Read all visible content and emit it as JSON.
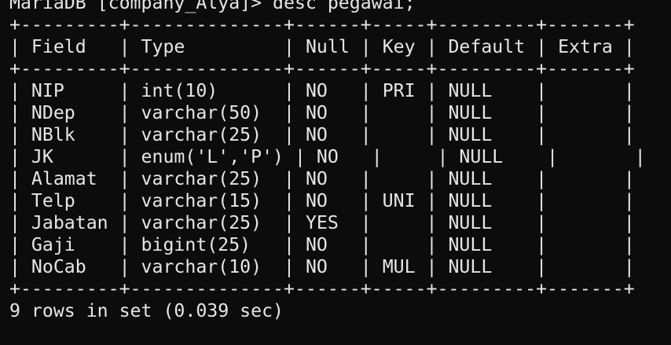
{
  "terminal": {
    "prompt": "MariaDB [company_Alya]> ",
    "command": "desc pegawai;",
    "border": "+---------+--------------+------+-----+---------+-------+",
    "headers": [
      "Field",
      "Type",
      "Null",
      "Key",
      "Default",
      "Extra"
    ],
    "rows": [
      {
        "field": "NIP",
        "type": "int(10)",
        "null": "NO",
        "key": "PRI",
        "default": "NULL",
        "extra": ""
      },
      {
        "field": "NDep",
        "type": "varchar(50)",
        "null": "NO",
        "key": "",
        "default": "NULL",
        "extra": ""
      },
      {
        "field": "NBlk",
        "type": "varchar(25)",
        "null": "NO",
        "key": "",
        "default": "NULL",
        "extra": ""
      },
      {
        "field": "JK",
        "type": "enum('L','P')",
        "null": "NO",
        "key": "",
        "default": "NULL",
        "extra": ""
      },
      {
        "field": "Alamat",
        "type": "varchar(25)",
        "null": "NO",
        "key": "",
        "default": "NULL",
        "extra": ""
      },
      {
        "field": "Telp",
        "type": "varchar(15)",
        "null": "NO",
        "key": "UNI",
        "default": "NULL",
        "extra": ""
      },
      {
        "field": "Jabatan",
        "type": "varchar(25)",
        "null": "YES",
        "key": "",
        "default": "NULL",
        "extra": ""
      },
      {
        "field": "Gaji",
        "type": "bigint(25)",
        "null": "NO",
        "key": "",
        "default": "NULL",
        "extra": ""
      },
      {
        "field": "NoCab",
        "type": "varchar(10)",
        "null": "NO",
        "key": "MUL",
        "default": "NULL",
        "extra": ""
      }
    ],
    "footer": "9 rows in set (0.039 sec)"
  },
  "colors": {
    "background": "#0c0c0c",
    "text": "#e6e6e6"
  }
}
